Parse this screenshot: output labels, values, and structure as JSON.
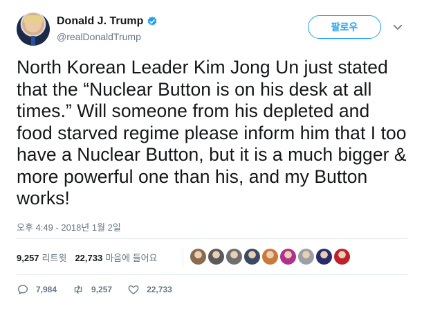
{
  "author": {
    "display_name": "Donald J. Trump",
    "handle": "@realDonaldTrump",
    "verified_icon": "verified-badge-icon",
    "avatar_icon": "avatar"
  },
  "follow_button": {
    "label": "팔로우"
  },
  "menu_caret": {
    "icon": "chevron-down-icon"
  },
  "tweet": {
    "text": "North Korean Leader Kim Jong Un just stated that the “Nuclear Button is on his desk at all times.” Will someone from his depleted and food starved regime please inform him that I too have a Nuclear Button, but it is a much bigger & more powerful one than his, and my Button works!",
    "timestamp": "오후 4:49 - 2018년 1월 2일"
  },
  "stats": {
    "retweets_count": "9,257",
    "retweets_label": "리트윗",
    "likes_count": "22,733",
    "likes_label": "마음에 들어요"
  },
  "likers": [
    {
      "color": "#8b6a4f"
    },
    {
      "color": "#5a5a5a"
    },
    {
      "color": "#6f6f6f"
    },
    {
      "color": "#3b4a63"
    },
    {
      "color": "#c97a3a"
    },
    {
      "color": "#b0308a"
    },
    {
      "color": "#9aa0a6"
    },
    {
      "color": "#2b2b6b"
    },
    {
      "color": "#c0202a"
    }
  ],
  "actions": {
    "reply_count": "7,984",
    "retweet_count": "9,257",
    "like_count": "22,733"
  },
  "colors": {
    "accent": "#1da1f2",
    "verified": "#1da1f2",
    "muted": "#657786"
  }
}
